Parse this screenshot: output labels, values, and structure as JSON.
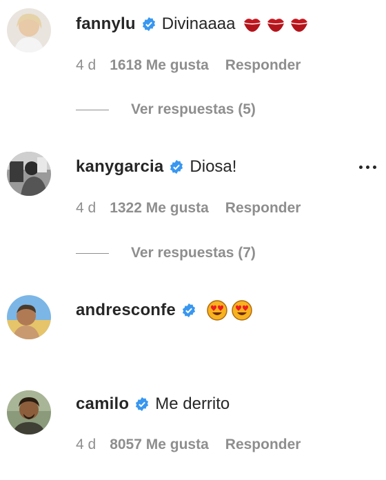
{
  "comments": [
    {
      "username": "fannylu",
      "verified": true,
      "text": "Divinaaaa",
      "emoji": [
        "kiss-mark",
        "kiss-mark",
        "kiss-mark"
      ],
      "time": "4 d",
      "likes": "1618 Me gusta",
      "reply": "Responder",
      "view_replies": "Ver respuestas (5)"
    },
    {
      "username": "kanygarcia",
      "verified": true,
      "text": "Diosa!",
      "emoji": [],
      "time": "4 d",
      "likes": "1322 Me gusta",
      "reply": "Responder",
      "view_replies": "Ver respuestas (7)"
    },
    {
      "username": "andresconfe",
      "verified": true,
      "text": "",
      "emoji": [
        "heart-eyes",
        "heart-eyes"
      ]
    },
    {
      "username": "camilo",
      "verified": true,
      "text": "Me derrito",
      "emoji": [],
      "time": "4 d",
      "likes": "8057 Me gusta",
      "reply": "Responder"
    }
  ],
  "colors": {
    "text": "#262626",
    "muted": "#8e8e8e",
    "verified": "#3897f0",
    "kiss": "#c4171f",
    "emoji_face": "#f7b21f",
    "emoji_heart": "#ed1c24"
  },
  "icons": {
    "verified": "verified-badge-icon",
    "more": "more-options-icon"
  }
}
